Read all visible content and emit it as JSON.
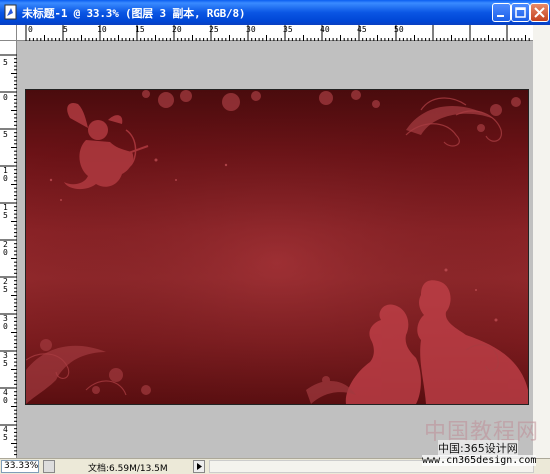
{
  "window": {
    "title": "未标题-1 @ 33.3% (图层 3 副本, RGB/8)",
    "controls": [
      "minimize-icon",
      "maximize-icon",
      "close-icon"
    ]
  },
  "ruler_top": {
    "labels": [
      "0",
      "5",
      "10",
      "15",
      "20",
      "25",
      "30",
      "35",
      "40",
      "45",
      "50"
    ]
  },
  "ruler_left": {
    "labels": [
      "5",
      "0",
      "5",
      "10",
      "15",
      "20",
      "25",
      "30",
      "35",
      "40",
      "45"
    ]
  },
  "status_bar": {
    "zoom": "33.33%",
    "doc_info": "文档:6.59M/13.5M"
  },
  "watermark": {
    "title": "中国教程网",
    "subtitle": "中国:365设计网",
    "url": "www.cn365design.com"
  },
  "colors": {
    "titlebar": "#0a56e4",
    "canvas_dark": "#4a0b0d",
    "canvas_mid": "#952a2d",
    "pasteboard": "#c0c0c0"
  }
}
